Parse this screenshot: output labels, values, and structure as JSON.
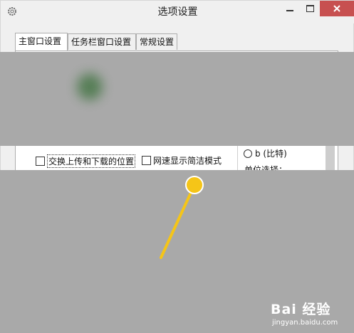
{
  "window": {
    "title": "选项设置"
  },
  "tabs": [
    {
      "label": "主窗口设置",
      "active": true
    },
    {
      "label": "任务栏窗口设置",
      "active": false
    },
    {
      "label": "常规设置",
      "active": false
    }
  ],
  "options": {
    "swap_upload_download": {
      "label": "交换上传和下载的位置",
      "checked": false
    },
    "simple_speed_mode": {
      "label": "网速显示简洁模式",
      "checked": false
    }
  },
  "unit": {
    "radio_label": "b (比特)",
    "selected": false,
    "section_label": "单位选择："
  },
  "watermark": {
    "brand": "Bai 经验",
    "url": "jingyan.baidu.com"
  },
  "colors": {
    "highlight": "#f5c518",
    "close_button": "#c75050",
    "blur": "#a9a9a9"
  }
}
